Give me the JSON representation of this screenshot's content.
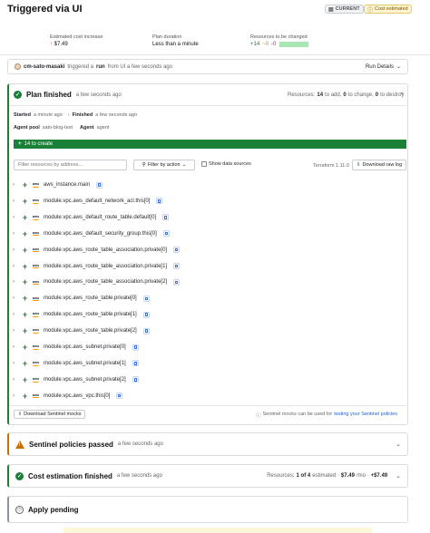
{
  "header": {
    "title": "Triggered via UI",
    "badge_current": "CURRENT",
    "badge_cost": "Cost estimated"
  },
  "stats": {
    "cost_label": "Estimated cost increase",
    "cost_value": "$7.49",
    "duration_label": "Plan duration",
    "duration_value": "Less than a minute",
    "resources_label": "Resources to be changed",
    "add": "+14",
    "change": "~0",
    "destroy": "-0"
  },
  "trigger": {
    "user": "cm-sato-masaki",
    "text_a": "triggered a",
    "run": "run",
    "text_b": "from UI a few seconds ago",
    "run_details": "Run Details"
  },
  "plan": {
    "title": "Plan finished",
    "time": "a few seconds ago",
    "resources_prefix": "Resources:",
    "to_add": "14",
    "to_add_label": "to add,",
    "to_change": "0",
    "to_change_label": "to change,",
    "to_destroy": "0",
    "to_destroy_label": "to destroy",
    "started_label": "Started",
    "started_value": "a minute ago",
    "finished_label": "Finished",
    "finished_value": "a few seconds ago",
    "agent_pool_label": "Agent pool",
    "agent_pool_value": "sato-blog-test",
    "agent_label": "Agent",
    "agent_value": "agent",
    "create_bar": "14 to create",
    "filter_placeholder": "Filter resources by address...",
    "filter_by_action": "Filter by action",
    "show_data_sources": "Show data sources",
    "terraform_version": "Terraform 1.11.0",
    "download_raw_log": "Download raw log",
    "resources": [
      "aws_instance.main",
      "module.vpc.aws_default_network_acl.this[0]",
      "module.vpc.aws_default_route_table.default[0]",
      "module.vpc.aws_default_security_group.this[0]",
      "module.vpc.aws_route_table_association.private[0]",
      "module.vpc.aws_route_table_association.private[1]",
      "module.vpc.aws_route_table_association.private[2]",
      "module.vpc.aws_route_table.private[0]",
      "module.vpc.aws_route_table.private[1]",
      "module.vpc.aws_route_table.private[2]",
      "module.vpc.aws_subnet.private[0]",
      "module.vpc.aws_subnet.private[1]",
      "module.vpc.aws_subnet.private[2]",
      "module.vpc.aws_vpc.this[0]"
    ],
    "aws_icon_text": "aws",
    "download_mocks": "Download Sentinel mocks",
    "mocks_note": "Sentinel mocks can be used for",
    "mocks_link": "testing your Sentinel policies"
  },
  "sentinel": {
    "title": "Sentinel policies passed",
    "time": "a few seconds ago"
  },
  "cost": {
    "title": "Cost estimation finished",
    "time": "a few seconds ago",
    "resources_prefix": "Resources:",
    "estimated": "1 of 4",
    "estimated_label": "estimated ·",
    "monthly": "$7.49",
    "per_mo": "/mo ·",
    "delta": "+$7.49"
  },
  "apply": {
    "title": "Apply pending"
  },
  "colors": {
    "green": "#1a7f37",
    "warning": "#c96f00",
    "link": "#1a5fd8"
  }
}
